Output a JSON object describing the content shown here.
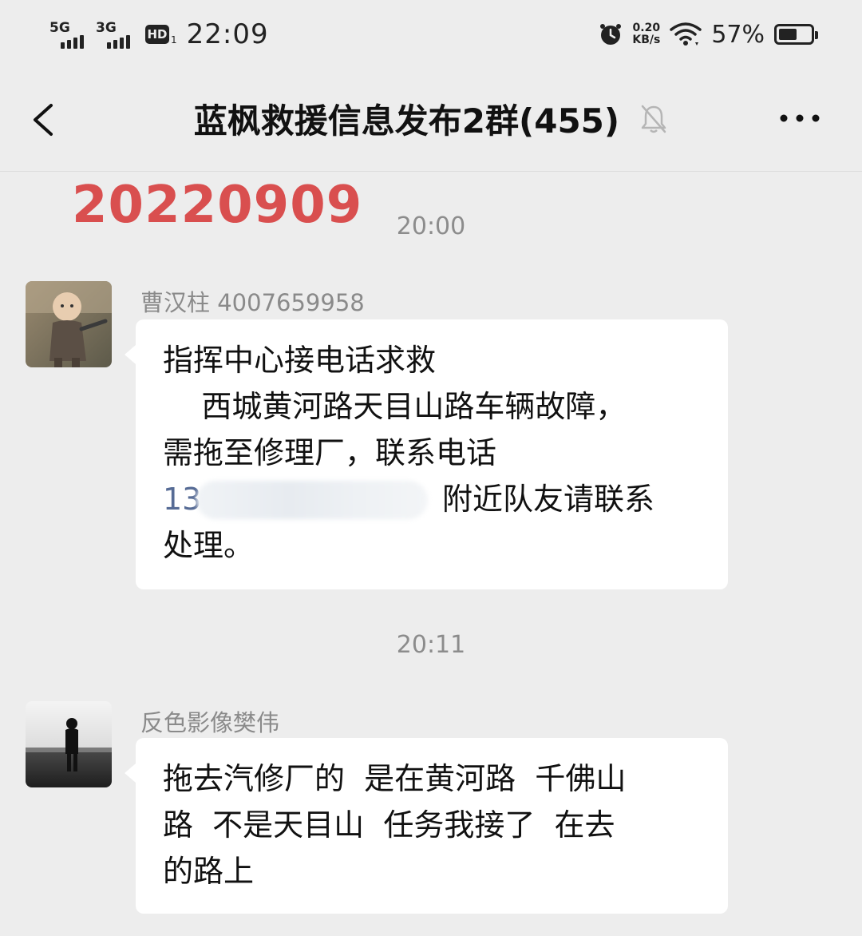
{
  "status_bar": {
    "sim1": "5G",
    "sim2": "3G",
    "hd": "HD",
    "hd_sub": "1",
    "time": "22:09",
    "speed_value": "0.20",
    "speed_unit": "KB/s",
    "battery_percent": "57%",
    "battery_level": 0.57
  },
  "nav": {
    "title": "蓝枫救援信息发布2群(455)",
    "back_icon": "chevron-left-icon",
    "mute_icon": "bell-muted-icon",
    "more_icon": "more-dots-icon"
  },
  "date_stamp": "20220909",
  "messages": [
    {
      "timestamp": "20:00",
      "sender": "曹汉柱  4007659958",
      "lines": [
        "指挥中心接电话求救",
        "    西城黄河路天目山路车辆故障，",
        "需拖至修理厂，联系电话"
      ],
      "phone_prefix": "13",
      "phone_rest": "附近队友请联系",
      "last_line": "处理。"
    },
    {
      "timestamp": "20:11",
      "sender": "反色影像樊伟",
      "lines": [
        "拖去汽修厂的  是在黄河路  千佛山",
        "路  不是天目山  任务我接了  在去",
        "的路上"
      ]
    }
  ],
  "colors": {
    "background": "#ededed",
    "stamp": "#d94f4f",
    "bubble": "#ffffff",
    "phone_link": "#566b95"
  }
}
